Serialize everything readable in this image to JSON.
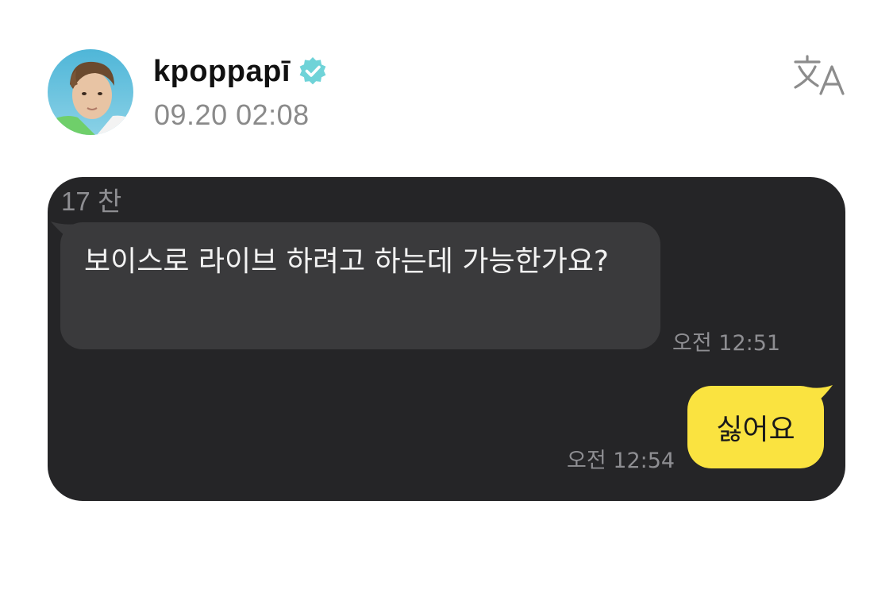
{
  "post": {
    "username": "kpoppapī",
    "verified_icon": "verified-badge-icon",
    "timestamp": "09.20 02:08",
    "translate_icon": "translate-icon",
    "avatar_icon": "profile-photo"
  },
  "chat": {
    "counter": "17 찬",
    "messages": [
      {
        "direction": "incoming",
        "text": "보이스로 라이브 하려고 하는데 가능한가요?",
        "time": "오전 12:51"
      },
      {
        "direction": "outgoing",
        "text": "싫어요",
        "time": "오전 12:54"
      }
    ]
  },
  "colors": {
    "card_bg": "#252527",
    "incoming_bubble": "#3a3a3c",
    "outgoing_bubble": "#fae340",
    "verified": "#6fd3d8",
    "meta_text": "#8a8a8a"
  }
}
